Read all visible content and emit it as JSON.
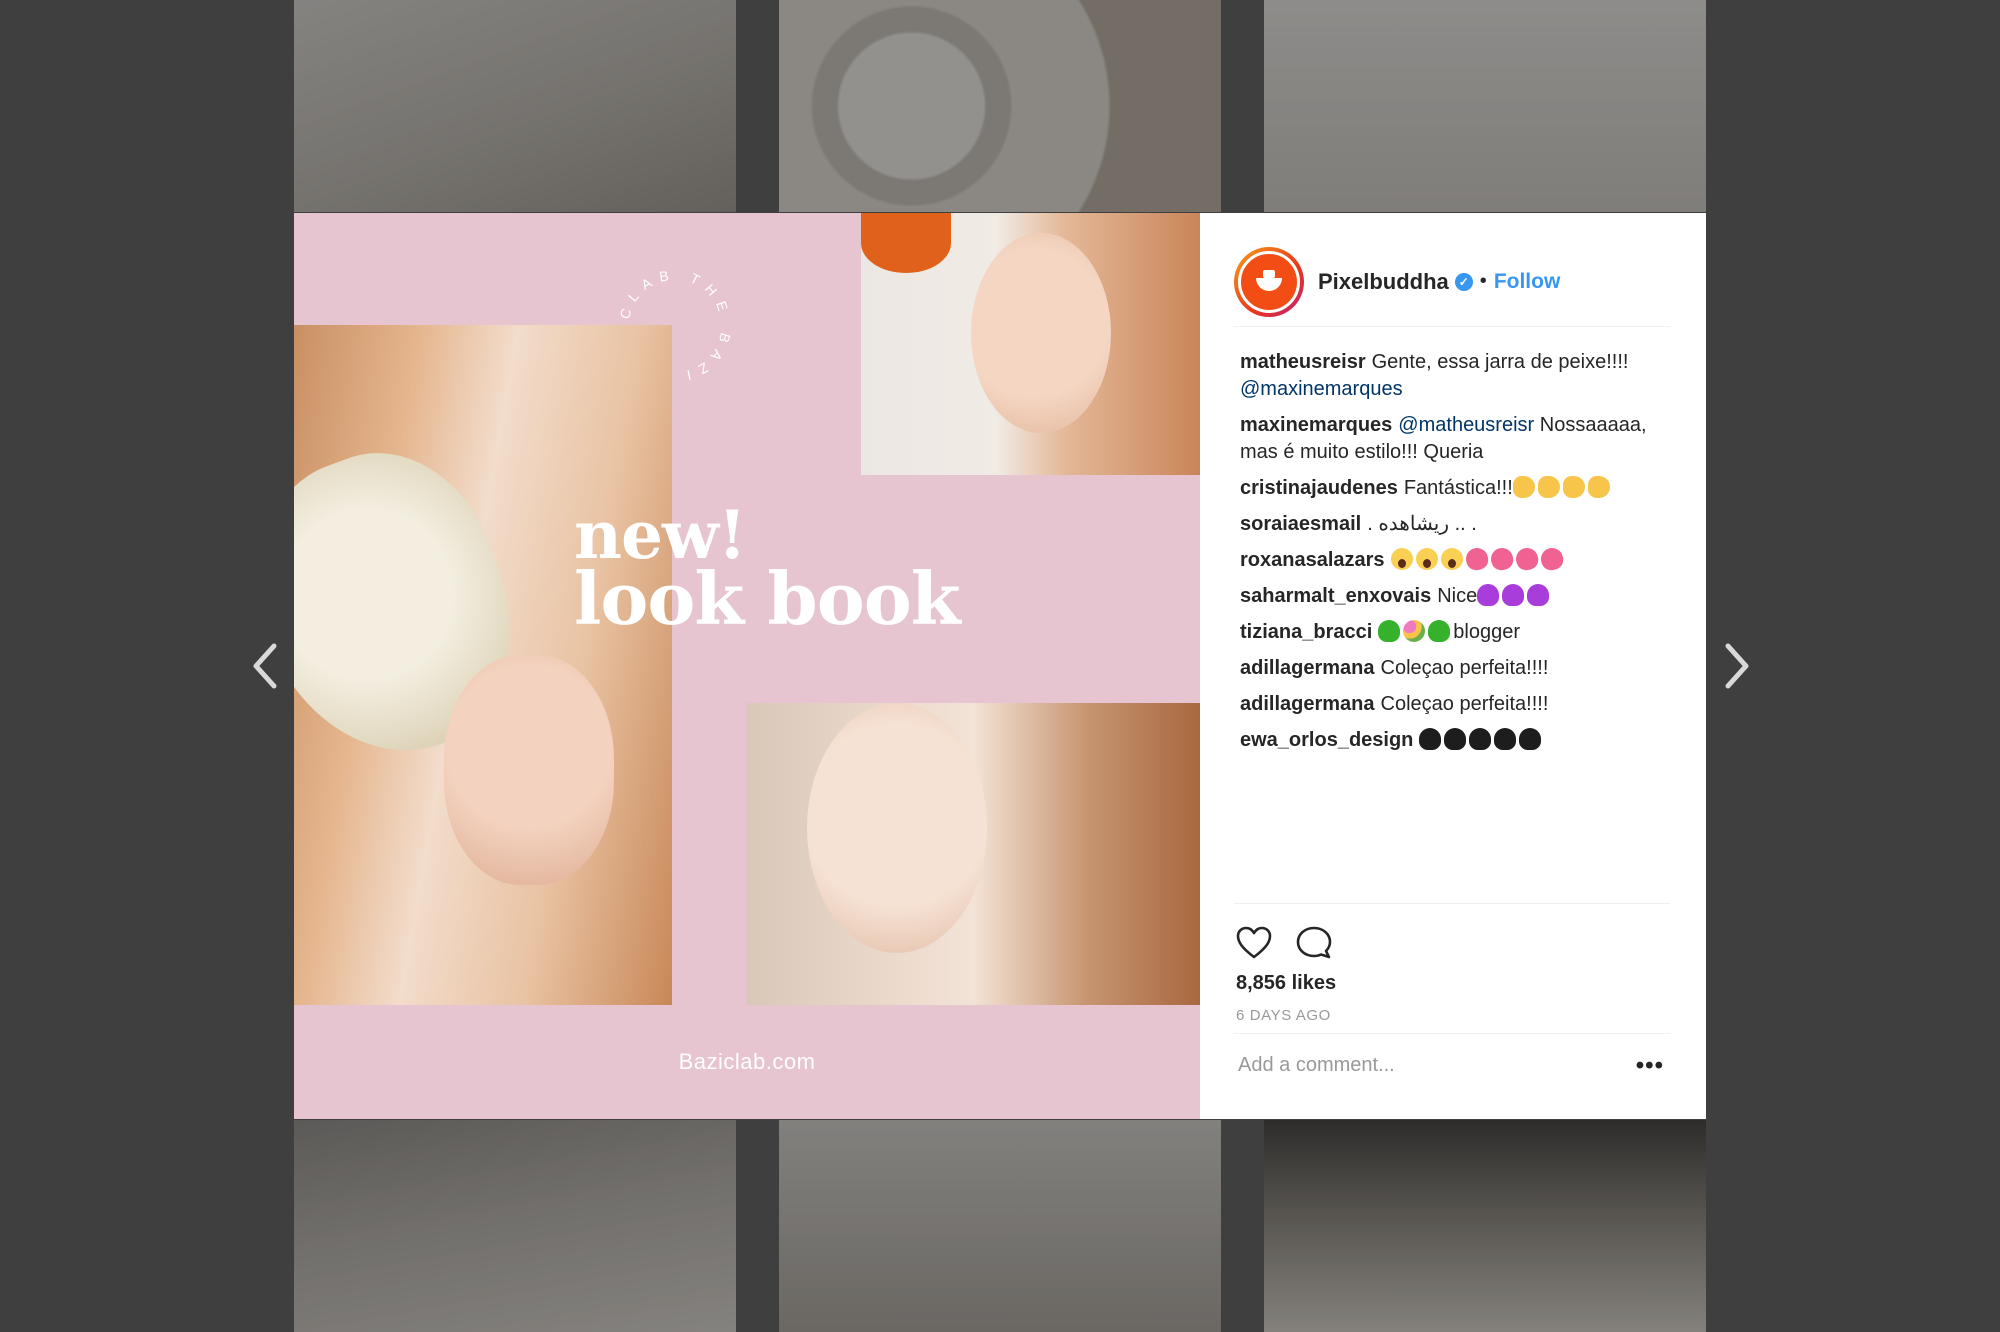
{
  "post": {
    "site_label": "Baziclab.com",
    "headline_line1": "new!",
    "headline_line2": "look book",
    "circle_text": "CLAB THE BAZI"
  },
  "header": {
    "username": "Pixelbuddha",
    "verified_mark": "✓",
    "separator": "•",
    "follow_label": "Follow"
  },
  "comments": [
    {
      "user": "matheusreisr",
      "text": "Gente, essa jarra de peixe!!!!",
      "mention": "@maxinemarques",
      "emojis": []
    },
    {
      "user": "maxinemarques",
      "mention": "@matheusreisr",
      "text": "Nossaaaaa, mas é muito estilo!!! Queria",
      "emojis": []
    },
    {
      "user": "cristinajaudenes",
      "text": "Fantástica!!!",
      "emojis": [
        "clap",
        "clap",
        "clap",
        "clap"
      ]
    },
    {
      "user": "soraiaesmail",
      "text": ". ريشاهده .. .",
      "emojis": []
    },
    {
      "user": "roxanasalazars",
      "text": "",
      "emojis": [
        "scream",
        "scream",
        "scream",
        "heart-pink",
        "heart-pink",
        "heart-pink",
        "heart-pink"
      ]
    },
    {
      "user": "saharmalt_enxovais",
      "text": "Nice",
      "emojis": [
        "heart-purple",
        "heart-purple",
        "heart-purple"
      ]
    },
    {
      "user": "tiziana_bracci",
      "text": "",
      "emojis": [
        "heart-green",
        "flowers",
        "heart-green"
      ],
      "suffix": "blogger"
    },
    {
      "user": "adillagermana",
      "text": "Coleçao perfeita!!!!",
      "emojis": []
    },
    {
      "user": "adillagermana",
      "text": "Coleçao perfeita!!!!",
      "emojis": []
    },
    {
      "user": "ewa_orlos_design",
      "text": "",
      "emojis": [
        "heart-black",
        "heart-black",
        "heart-black",
        "heart-black",
        "heart-black"
      ]
    }
  ],
  "actions": {
    "likes": "8,856 likes",
    "time_ago": "6 DAYS AGO",
    "comment_placeholder": "Add a comment...",
    "more_label": "•••"
  },
  "colors": {
    "accent_blue": "#3897f0",
    "pink_background": "#e6c4d0",
    "overlay": "#3f3f3f"
  }
}
